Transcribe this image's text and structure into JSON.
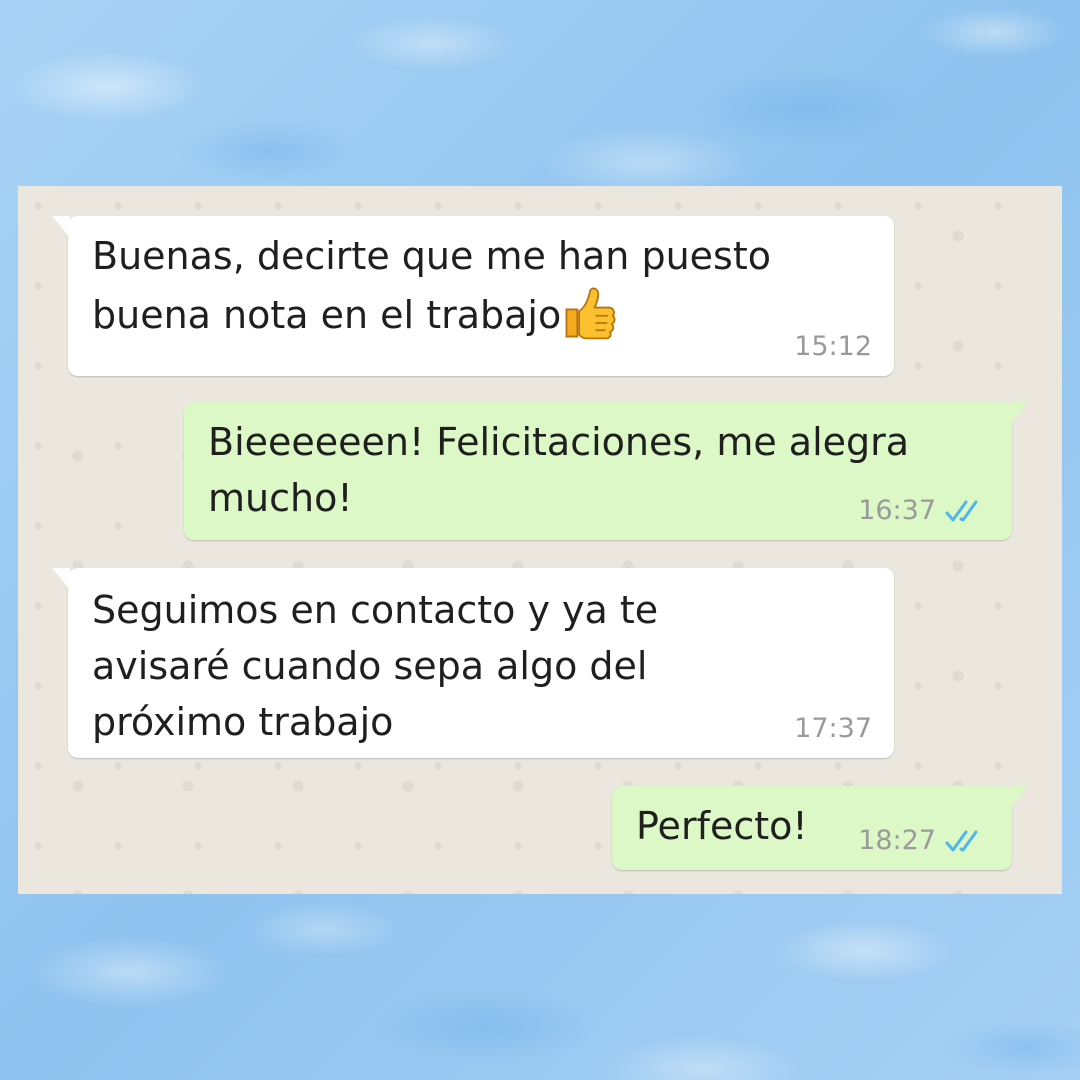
{
  "chat": {
    "messages": [
      {
        "direction": "incoming",
        "text": "Buenas, decirte que me han puesto\nbuena nota en el trabajo",
        "emoji": "thumbs-up",
        "time": "15:12"
      },
      {
        "direction": "outgoing",
        "text": "Bieeeeeen! Felicitaciones, me alegra\nmucho!",
        "time": "16:37",
        "status": "read"
      },
      {
        "direction": "incoming",
        "text": "Seguimos en contacto y ya te\navisaré cuando sepa algo del\npróximo trabajo",
        "time": "17:37"
      },
      {
        "direction": "outgoing",
        "text": "Perfecto!",
        "time": "18:27",
        "status": "read"
      }
    ]
  },
  "colors": {
    "outgoing_bubble": "#dcf8c6",
    "incoming_bubble": "#ffffff",
    "chat_background": "#ebe6de",
    "read_ticks": "#4fb6ec",
    "page_background": "#9fcdf3"
  }
}
